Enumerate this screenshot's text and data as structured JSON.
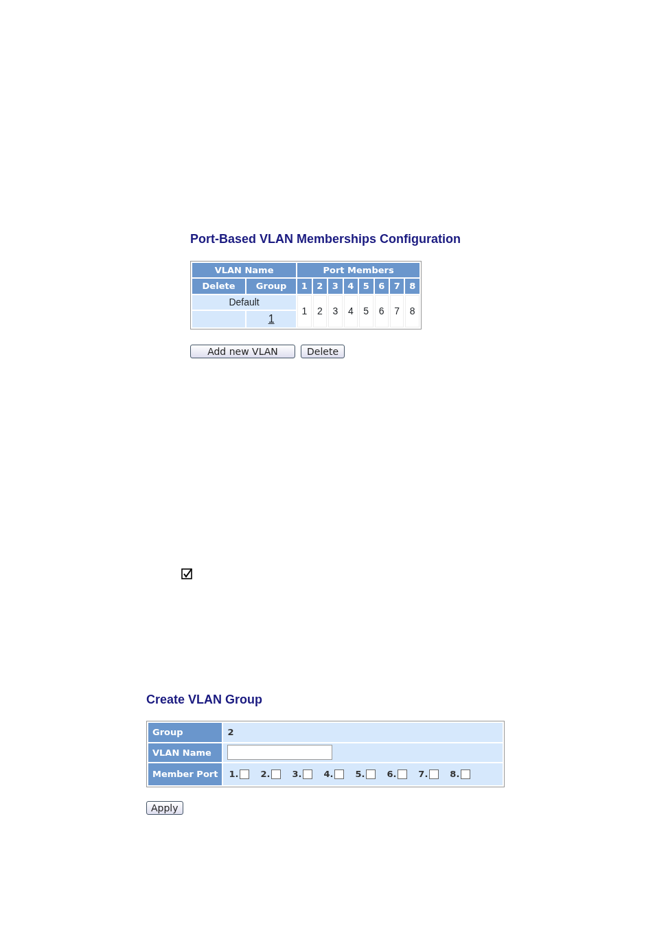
{
  "membership": {
    "title": "Port-Based VLAN Memberships Configuration",
    "header_top": [
      "VLAN Name",
      "Port Members"
    ],
    "header_sub": [
      "Delete",
      "Group"
    ],
    "ports": [
      "1",
      "2",
      "3",
      "4",
      "5",
      "6",
      "7",
      "8"
    ],
    "rows": [
      {
        "name": "Default",
        "group": "1",
        "members": [
          "1",
          "2",
          "3",
          "4",
          "5",
          "6",
          "7",
          "8"
        ]
      }
    ],
    "buttons": [
      "Add new VLAN",
      "Delete"
    ]
  },
  "standalone_checkbox": {
    "checked": true
  },
  "create": {
    "title": "Create VLAN Group",
    "group_label": "Group",
    "group_value": "2",
    "name_label": "VLAN Name",
    "member_label": "Member Port",
    "ports": [
      {
        "label": "1.",
        "checked": false
      },
      {
        "label": "2.",
        "checked": false
      },
      {
        "label": "3.",
        "checked": false
      },
      {
        "label": "4.",
        "checked": false
      },
      {
        "label": "5.",
        "checked": false
      },
      {
        "label": "6.",
        "checked": false
      },
      {
        "label": "7.",
        "checked": false
      },
      {
        "label": "8.",
        "checked": false
      }
    ],
    "apply": "Apply"
  }
}
